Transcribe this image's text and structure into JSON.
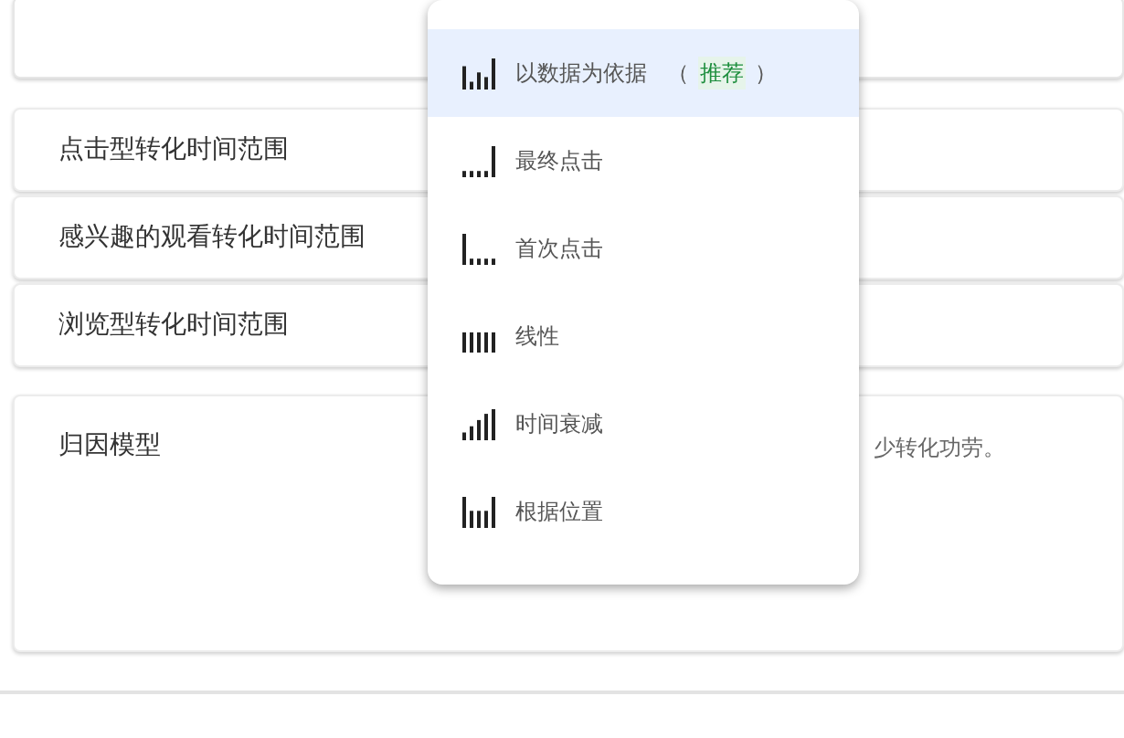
{
  "rows": [
    {
      "label": "点击型转化时间范围"
    },
    {
      "label": "感兴趣的观看转化时间范围"
    },
    {
      "label": "浏览型转化时间范围"
    }
  ],
  "attribution": {
    "label": "归因模型",
    "description": "少转化功劳。"
  },
  "menu": {
    "items": [
      {
        "kind": "data_driven",
        "label": "以数据为依据",
        "paren_open": "（",
        "badge": "推荐",
        "paren_close": "）",
        "selected": true
      },
      {
        "kind": "last_click",
        "label": "最终点击",
        "selected": false
      },
      {
        "kind": "first_click",
        "label": "首次点击",
        "selected": false
      },
      {
        "kind": "linear",
        "label": "线性",
        "selected": false
      },
      {
        "kind": "time_decay",
        "label": "时间衰减",
        "selected": false
      },
      {
        "kind": "position",
        "label": "根据位置",
        "selected": false
      }
    ]
  }
}
